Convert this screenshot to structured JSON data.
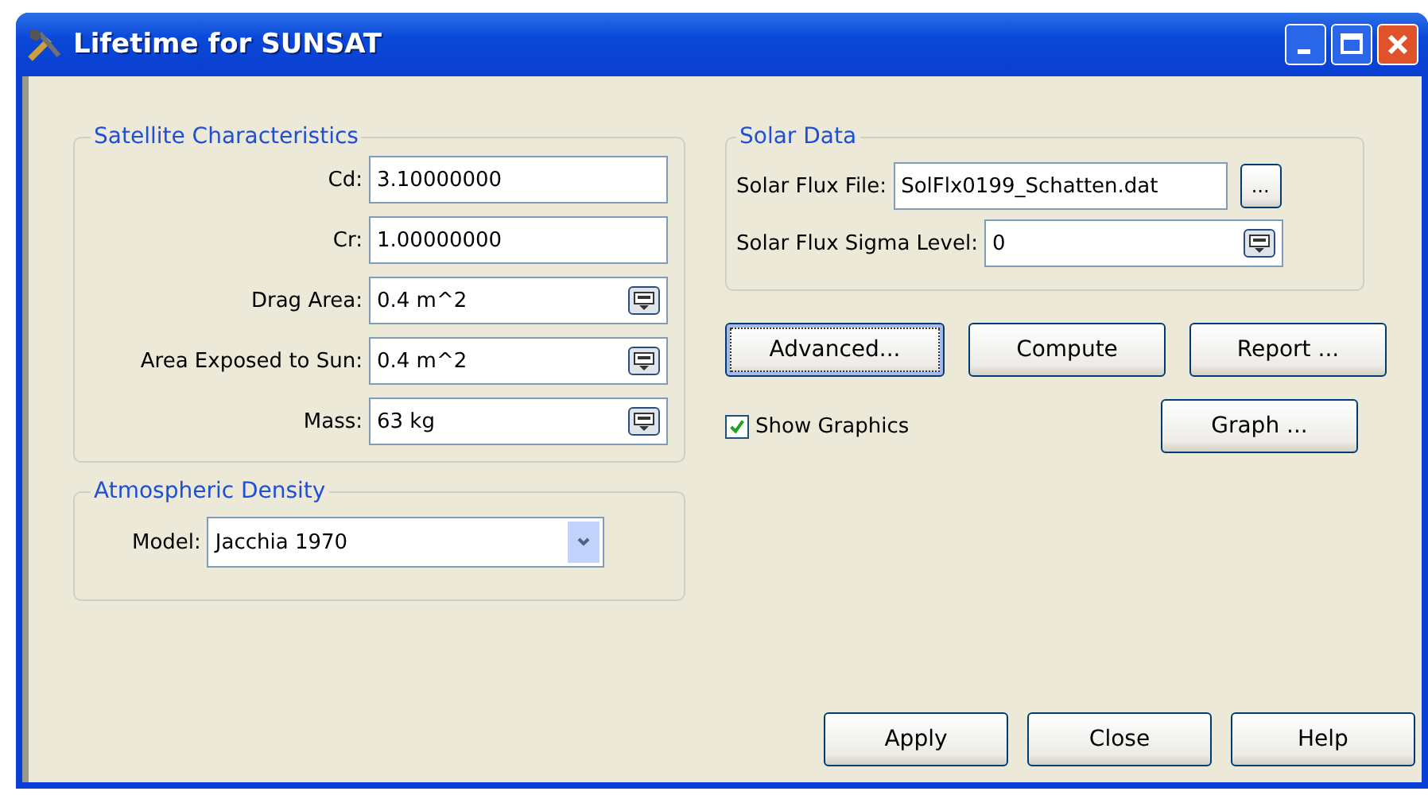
{
  "window": {
    "title": "Lifetime for SUNSAT"
  },
  "satellite_characteristics": {
    "title": "Satellite Characteristics",
    "fields": [
      {
        "label": "Cd:",
        "value": "3.10000000",
        "kind": "text"
      },
      {
        "label": "Cr:",
        "value": "1.00000000",
        "kind": "text"
      },
      {
        "label": "Drag Area:",
        "value": "0.4 m^2",
        "kind": "unit"
      },
      {
        "label": "Area Exposed to Sun:",
        "value": "0.4 m^2",
        "kind": "unit"
      },
      {
        "label": "Mass:",
        "value": "63 kg",
        "kind": "unit"
      }
    ]
  },
  "atmospheric_density": {
    "title": "Atmospheric Density",
    "model_label": "Model:",
    "model": "Jacchia 1970"
  },
  "solar_data": {
    "title": "Solar Data",
    "file_label": "Solar Flux File:",
    "file": "SolFlx0199_Schatten.dat",
    "browse": "...",
    "sigma_label": "Solar Flux Sigma Level:",
    "sigma": "0"
  },
  "actions": [
    {
      "label": "Advanced...",
      "focused": true
    },
    {
      "label": "Compute",
      "focused": false
    },
    {
      "label": "Report ...",
      "focused": false
    }
  ],
  "show_graphics": {
    "label": "Show Graphics",
    "checked": true
  },
  "graph_button": "Graph ...",
  "buttons": [
    "Apply",
    "Close",
    "Help"
  ]
}
